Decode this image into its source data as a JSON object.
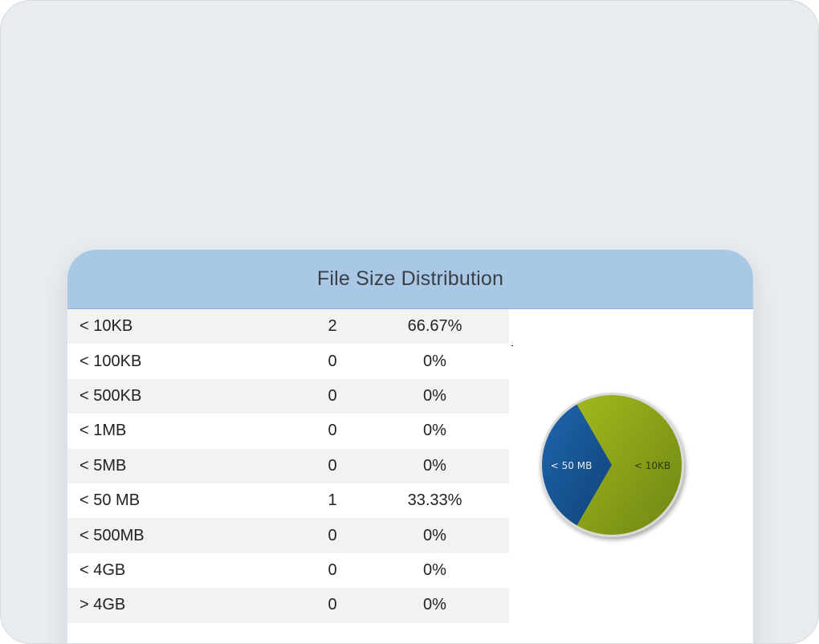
{
  "card": {
    "title": "File Size Distribution"
  },
  "table": {
    "rows": [
      {
        "label": "< 10KB",
        "count": "2",
        "percent": "66.67%"
      },
      {
        "label": "< 100KB",
        "count": "0",
        "percent": "0%"
      },
      {
        "label": "< 500KB",
        "count": "0",
        "percent": "0%"
      },
      {
        "label": "< 1MB",
        "count": "0",
        "percent": "0%"
      },
      {
        "label": "< 5MB",
        "count": "0",
        "percent": "0%"
      },
      {
        "label": "< 50 MB",
        "count": "1",
        "percent": "33.33%"
      },
      {
        "label": "< 500MB",
        "count": "0",
        "percent": "0%"
      },
      {
        "label": "< 4GB",
        "count": "0",
        "percent": "0%"
      },
      {
        "label": "> 4GB",
        "count": "0",
        "percent": "0%"
      }
    ]
  },
  "pie": {
    "slices": [
      {
        "label": "< 10KB",
        "value": 66.67,
        "color": "#8aa318"
      },
      {
        "label": "< 50 MB",
        "value": 33.33,
        "color": "#1a5a9a"
      }
    ]
  }
}
